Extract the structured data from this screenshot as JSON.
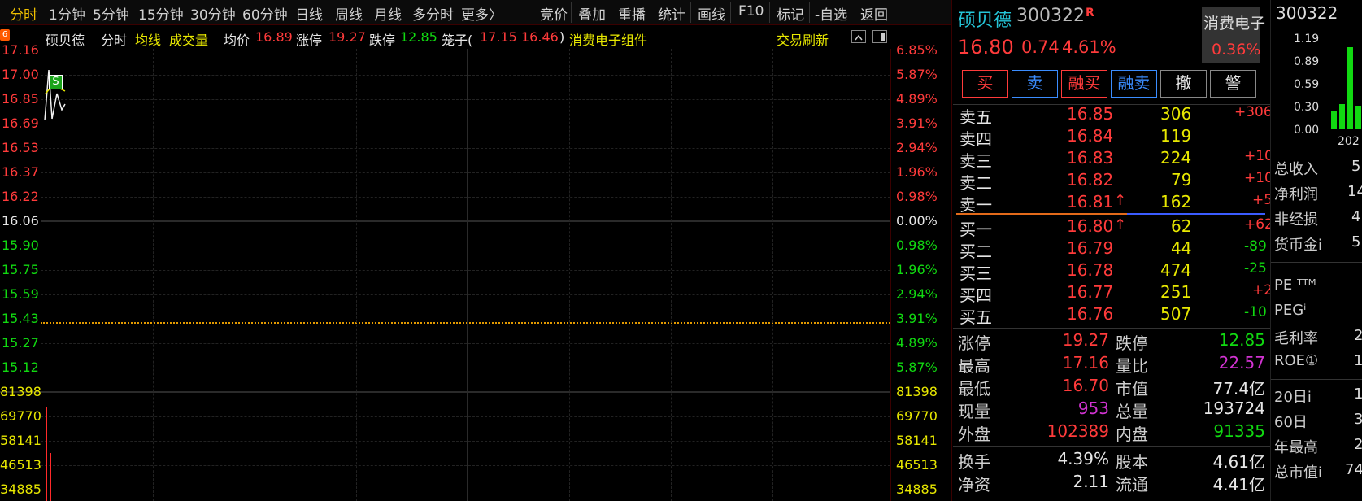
{
  "toolbar": {
    "tabs": [
      "分时",
      "1分钟",
      "5分钟",
      "15分钟",
      "30分钟",
      "60分钟",
      "日线",
      "周线",
      "月线",
      "多分时",
      "更多〉"
    ],
    "active": "分时",
    "tools": [
      "竞价",
      "叠加",
      "重播",
      "统计",
      "画线",
      "F10",
      "标记",
      "-自选",
      "返回"
    ]
  },
  "infoline": {
    "badge": "6",
    "name": "硕贝德",
    "mode": "分时",
    "avg_line": "均线",
    "volume": "成交量",
    "avg_price_label": "均价",
    "avg_price": "16.89",
    "limit_up_label": "涨停",
    "limit_up": "19.27",
    "limit_down_label": "跌停",
    "limit_down": "12.85",
    "cage": "笼子(",
    "cage_high": "17.15",
    "cage_low": "16.46",
    "cage_end": ")",
    "sector": "消费电子组件",
    "refresh": "交易刷新"
  },
  "price_axis": {
    "left": [
      "17.16",
      "17.00",
      "16.85",
      "16.69",
      "16.53",
      "16.37",
      "16.22",
      "16.06",
      "15.90",
      "15.75",
      "15.59",
      "15.43",
      "15.27",
      "15.12"
    ],
    "right": [
      "6.85%",
      "5.87%",
      "4.89%",
      "3.91%",
      "2.94%",
      "1.96%",
      "0.98%",
      "0.00%",
      "0.98%",
      "1.96%",
      "2.94%",
      "3.91%",
      "4.89%",
      "5.87%"
    ]
  },
  "volume_axis": {
    "left": [
      "81398",
      "69770",
      "58141",
      "46513",
      "34885"
    ],
    "right": [
      "81398",
      "69770",
      "58141",
      "46513",
      "34885"
    ]
  },
  "chart_marker": "S",
  "stock": {
    "name": "硕贝德",
    "code": "300322",
    "flag": "R",
    "price": "16.80",
    "change": "0.74",
    "change_pct": "4.61%",
    "sector": "消费电子",
    "sector_pct": "0.36%"
  },
  "buttons": [
    "买",
    "卖",
    "融买",
    "融卖",
    "撤",
    "警"
  ],
  "sell_orders": [
    {
      "label": "卖五",
      "price": "16.85",
      "vol": "306",
      "delta": "+306",
      "arrow": ""
    },
    {
      "label": "卖四",
      "price": "16.84",
      "vol": "119",
      "delta": "",
      "arrow": ""
    },
    {
      "label": "卖三",
      "price": "16.83",
      "vol": "224",
      "delta": "+10",
      "arrow": ""
    },
    {
      "label": "卖二",
      "price": "16.82",
      "vol": "79",
      "delta": "+10",
      "arrow": ""
    },
    {
      "label": "卖一",
      "price": "16.81",
      "vol": "162",
      "delta": "+5",
      "arrow": "↑"
    }
  ],
  "buy_orders": [
    {
      "label": "买一",
      "price": "16.80",
      "vol": "62",
      "delta": "+62",
      "arrow": "↑"
    },
    {
      "label": "买二",
      "price": "16.79",
      "vol": "44",
      "delta": "-89",
      "arrow": ""
    },
    {
      "label": "买三",
      "price": "16.78",
      "vol": "474",
      "delta": "-25",
      "arrow": ""
    },
    {
      "label": "买四",
      "price": "16.77",
      "vol": "251",
      "delta": "+2",
      "arrow": ""
    },
    {
      "label": "买五",
      "price": "16.76",
      "vol": "507",
      "delta": "-10",
      "arrow": ""
    }
  ],
  "stats": {
    "limit_up_label": "涨停",
    "limit_up": "19.27",
    "limit_down_label": "跌停",
    "limit_down": "12.85",
    "high_label": "最高",
    "high": "17.16",
    "vol_ratio_label": "量比",
    "vol_ratio": "22.57",
    "low_label": "最低",
    "low": "16.70",
    "mkt_value_label": "市值",
    "mkt_value": "77.4亿",
    "cur_vol_label": "现量",
    "cur_vol": "953",
    "total_vol_label": "总量",
    "total_vol": "193724",
    "outer_label": "外盘",
    "outer": "102389",
    "inner_label": "内盘",
    "inner": "91335",
    "turnover_label": "换手",
    "turnover": "4.39%",
    "shares_label": "股本",
    "shares": "4.61亿",
    "nav_label": "净资",
    "nav": "2.11",
    "float_label": "流通",
    "float": "4.41亿"
  },
  "far_panel": {
    "code": "300322",
    "bar_axis": [
      "1.19",
      "0.89",
      "0.59",
      "0.30",
      "0.00"
    ],
    "year_label": "202",
    "bar_values": [
      0.22,
      0.3,
      1.0,
      0.28
    ],
    "fin_labels": [
      "总收入",
      "净利润",
      "非经损",
      "货币金i"
    ],
    "fin_values": [
      "5",
      "14",
      "4",
      "5"
    ],
    "ratio_labels": [
      "PE ᵀᵀᴹ",
      "PEGⁱ",
      "毛利率",
      "ROE①"
    ],
    "ratio_values": [
      "",
      "",
      "2",
      "1"
    ],
    "period_labels": [
      "20日i",
      "60日",
      "年最高",
      "总市值i"
    ],
    "period_values": [
      "1",
      "3",
      "2",
      "74"
    ]
  },
  "colors": {
    "up": "#ff3b3b",
    "down": "#11d911",
    "accent": "#f0c000",
    "bg": "#000000"
  }
}
